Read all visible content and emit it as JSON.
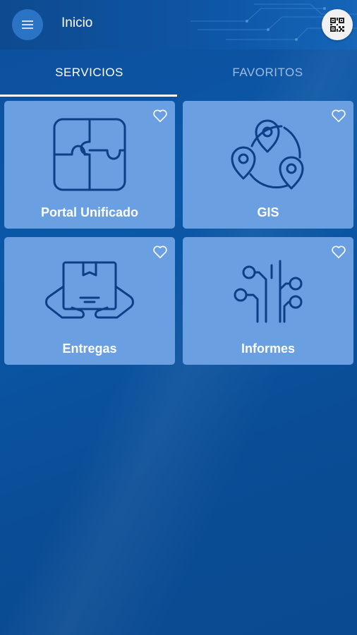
{
  "header": {
    "title": "Inicio",
    "menu_icon": "hamburger-icon",
    "qr_icon": "qr-code-icon"
  },
  "tabs": [
    {
      "label": "SERVICIOS",
      "active": true
    },
    {
      "label": "FAVORITOS",
      "active": false
    }
  ],
  "services": [
    {
      "label": "Portal Unificado",
      "icon": "puzzle-icon",
      "favorite": false
    },
    {
      "label": "GIS",
      "icon": "map-pins-icon",
      "favorite": false
    },
    {
      "label": "Entregas",
      "icon": "package-hands-icon",
      "favorite": false
    },
    {
      "label": "Informes",
      "icon": "circuit-icon",
      "favorite": false
    }
  ],
  "colors": {
    "background": "#0b58a8",
    "card": "#6a9fe2",
    "icon_stroke": "#0d3f86",
    "active_tab": "#ffffff",
    "inactive_tab": "#9fbbe0"
  }
}
